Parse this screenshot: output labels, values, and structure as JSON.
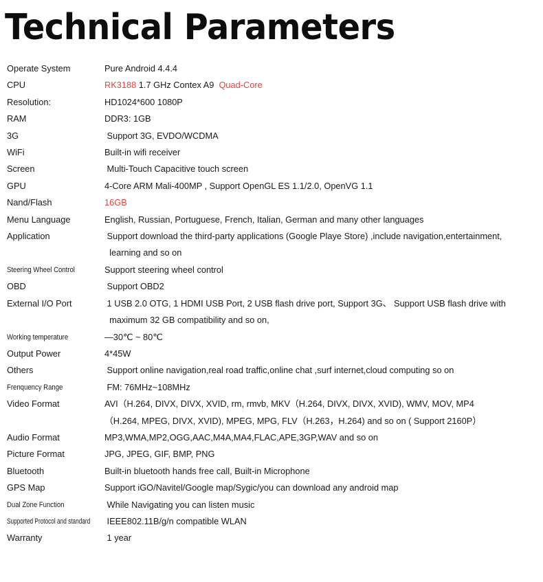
{
  "document": {
    "title": "Technical Parameters",
    "background_color": "#ffffff",
    "text_color": "#1a1a1a",
    "highlight_color": "#e8443c"
  },
  "spec_table": {
    "rows": [
      {
        "label": "Operate System",
        "label_style": "normal",
        "lines": [
          [
            {
              "text": "Pure Android 4.4.4",
              "highlight": false
            }
          ]
        ]
      },
      {
        "label": "CPU",
        "label_style": "normal",
        "lines": [
          [
            {
              "text": "RK3188",
              "highlight": true
            },
            {
              "text": " 1.7 GHz Contex A9  ",
              "highlight": false
            },
            {
              "text": "Quad-Core",
              "highlight": true
            }
          ]
        ]
      },
      {
        "label": "Resolution:",
        "label_style": "normal",
        "lines": [
          [
            {
              "text": "HD1024*600 1080P",
              "highlight": false
            }
          ]
        ]
      },
      {
        "label": "RAM",
        "label_style": "normal",
        "lines": [
          [
            {
              "text": "DDR3: 1GB",
              "highlight": false
            }
          ]
        ]
      },
      {
        "label": "3G",
        "label_style": "normal",
        "lines": [
          [
            {
              "text": " Support 3G, EVDO/WCDMA",
              "highlight": false
            }
          ]
        ]
      },
      {
        "label": "WiFi",
        "label_style": "normal",
        "lines": [
          [
            {
              "text": "Built-in wifi receiver",
              "highlight": false
            }
          ]
        ]
      },
      {
        "label": "Screen",
        "label_style": "normal",
        "lines": [
          [
            {
              "text": " Multi-Touch Capacitive touch screen",
              "highlight": false
            }
          ]
        ]
      },
      {
        "label": "GPU",
        "label_style": "normal",
        "lines": [
          [
            {
              "text": "4-Core ARM Mali-400MP , Support OpenGL ES 1.1/2.0, OpenVG 1.1",
              "highlight": false
            }
          ]
        ]
      },
      {
        "label": "Nand/Flash",
        "label_style": "normal",
        "lines": [
          [
            {
              "text": "16GB",
              "highlight": true
            }
          ]
        ]
      },
      {
        "label": "Menu Language",
        "label_style": "normal",
        "lines": [
          [
            {
              "text": "English, Russian, Portuguese, French, Italian, German and many other languages",
              "highlight": false
            }
          ]
        ]
      },
      {
        "label": "Application",
        "label_style": "normal",
        "lines": [
          [
            {
              "text": " Support download the third-party applications (Google Playe Store) ,include navigation,entertainment,",
              "highlight": false
            }
          ],
          [
            {
              "text": "  learning and so on",
              "highlight": false
            }
          ]
        ]
      },
      {
        "label": "Steering Wheel Control",
        "label_style": "condensed",
        "lines": [
          [
            {
              "text": "Support steering wheel control",
              "highlight": false
            }
          ]
        ]
      },
      {
        "label": "OBD",
        "label_style": "normal",
        "lines": [
          [
            {
              "text": " Support OBD2",
              "highlight": false
            }
          ]
        ]
      },
      {
        "label": "External I/O Port",
        "label_style": "normal",
        "lines": [
          [
            {
              "text": " 1 USB 2.0 OTG, 1 HDMI USB Port, 2 USB flash drive port, Support 3G、 Support USB flash drive with",
              "highlight": false
            }
          ],
          [
            {
              "text": "  maximum 32 GB compatibility and so on,",
              "highlight": false
            }
          ]
        ]
      },
      {
        "label": "Working temperature",
        "label_style": "condensed",
        "lines": [
          [
            {
              "text": "—30℃ ~ 80℃",
              "highlight": false
            }
          ]
        ]
      },
      {
        "label": "Output Power",
        "label_style": "normal",
        "lines": [
          [
            {
              "text": "4*45W",
              "highlight": false
            }
          ]
        ]
      },
      {
        "label": "Others",
        "label_style": "normal",
        "lines": [
          [
            {
              "text": " Support online navigation,real road traffic,online chat ,surf internet,cloud computing so on",
              "highlight": false
            }
          ]
        ]
      },
      {
        "label": "Frenquency Range",
        "label_style": "condensed",
        "lines": [
          [
            {
              "text": " FM: 76MHz~108MHz",
              "highlight": false
            }
          ]
        ]
      },
      {
        "label": "Video  Format",
        "label_style": "normal",
        "lines": [
          [
            {
              "text": "AVI（H.264, DIVX, DIVX, XVID, rm, rmvb, MKV（H.264, DIVX, DIVX, XVID), WMV, MOV, MP4",
              "highlight": false
            }
          ],
          [
            {
              "text": "（H.264, MPEG, DIVX, XVID), MPEG, MPG, FLV（H.263，H.264) and so on ( Support 2160P）",
              "highlight": false
            }
          ]
        ]
      },
      {
        "label": "Audio Format",
        "label_style": "normal",
        "lines": [
          [
            {
              "text": "MP3,WMA,MP2,OGG,AAC,M4A,MA4,FLAC,APE,3GP,WAV and so on",
              "highlight": false
            }
          ]
        ]
      },
      {
        "label": "Picture Format",
        "label_style": "normal",
        "lines": [
          [
            {
              "text": "JPG, JPEG, GIF, BMP, PNG",
              "highlight": false
            }
          ]
        ]
      },
      {
        "label": "Bluetooth",
        "label_style": "normal",
        "lines": [
          [
            {
              "text": "Built-in bluetooth hands free call, Built-in Microphone",
              "highlight": false
            }
          ]
        ]
      },
      {
        "label": "GPS Map",
        "label_style": "normal",
        "lines": [
          [
            {
              "text": "Support iGO/Navitel/Google map/Sygic/you can download any android map",
              "highlight": false
            }
          ]
        ]
      },
      {
        "label": "Dual Zone Function",
        "label_style": "condensed",
        "lines": [
          [
            {
              "text": " While Navigating you can listen music",
              "highlight": false
            }
          ]
        ]
      },
      {
        "label": "Supported Protocol and standard",
        "label_style": "condensed-more",
        "lines": [
          [
            {
              "text": " IEEE802.11B/g/n compatible WLAN",
              "highlight": false
            }
          ]
        ]
      },
      {
        "label": "Warranty",
        "label_style": "normal",
        "lines": [
          [
            {
              "text": " 1 year",
              "highlight": false
            }
          ]
        ]
      }
    ]
  }
}
